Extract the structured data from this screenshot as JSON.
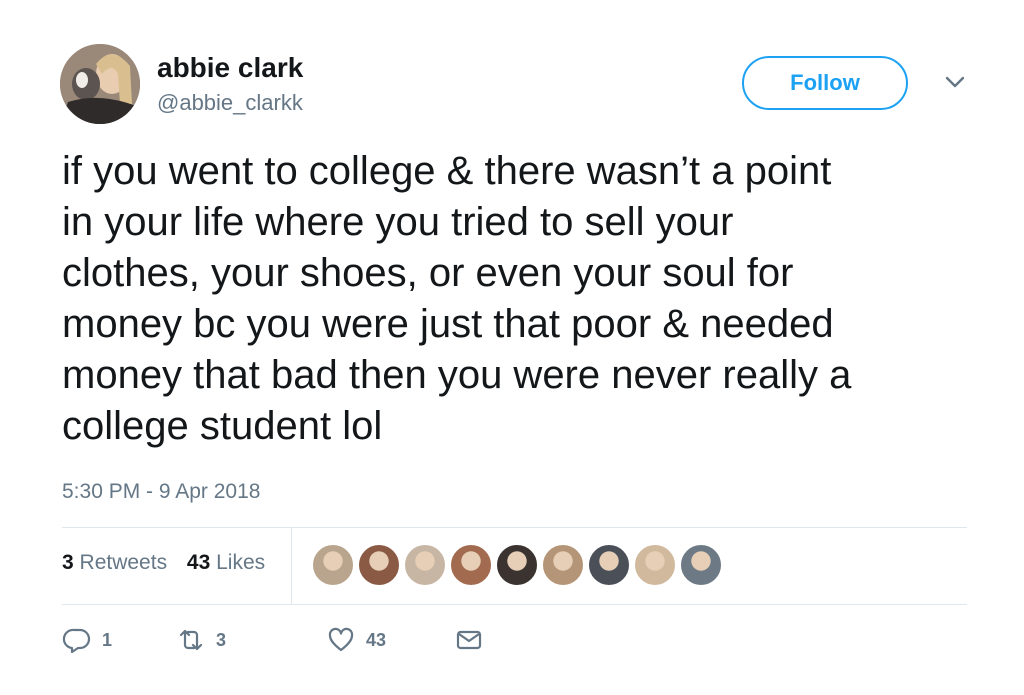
{
  "author": {
    "display_name": "abbie clark",
    "username": "@abbie_clarkk",
    "avatar_icon": "avatar-photo"
  },
  "follow_label": "Follow",
  "tweet_lines": [
    "if you went to college & there wasn’t a point",
    "in your life where you tried to sell your",
    "clothes, your shoes, or even your soul for",
    "money bc you were just that poor & needed",
    "money that bad then you were never really a",
    "college student lol"
  ],
  "timestamp": "5:30 PM - 9 Apr 2018",
  "stats": {
    "retweets_count": "3",
    "retweets_label": "Retweets",
    "likes_count": "43",
    "likes_label": "Likes"
  },
  "likers": [
    {
      "color": "#b9a48d"
    },
    {
      "color": "#8a5a44"
    },
    {
      "color": "#c7b6a4"
    },
    {
      "color": "#a26b4f"
    },
    {
      "color": "#3a3330"
    },
    {
      "color": "#b59577"
    },
    {
      "color": "#4a4f58"
    },
    {
      "color": "#d1b99d"
    },
    {
      "color": "#6d7a86"
    }
  ],
  "actions": {
    "reply_count": "1",
    "retweet_count": "3",
    "like_count": "43"
  },
  "colors": {
    "accent": "#1da1f2",
    "text": "#14171a",
    "secondary": "#657786",
    "divider": "#e1e8ed"
  }
}
